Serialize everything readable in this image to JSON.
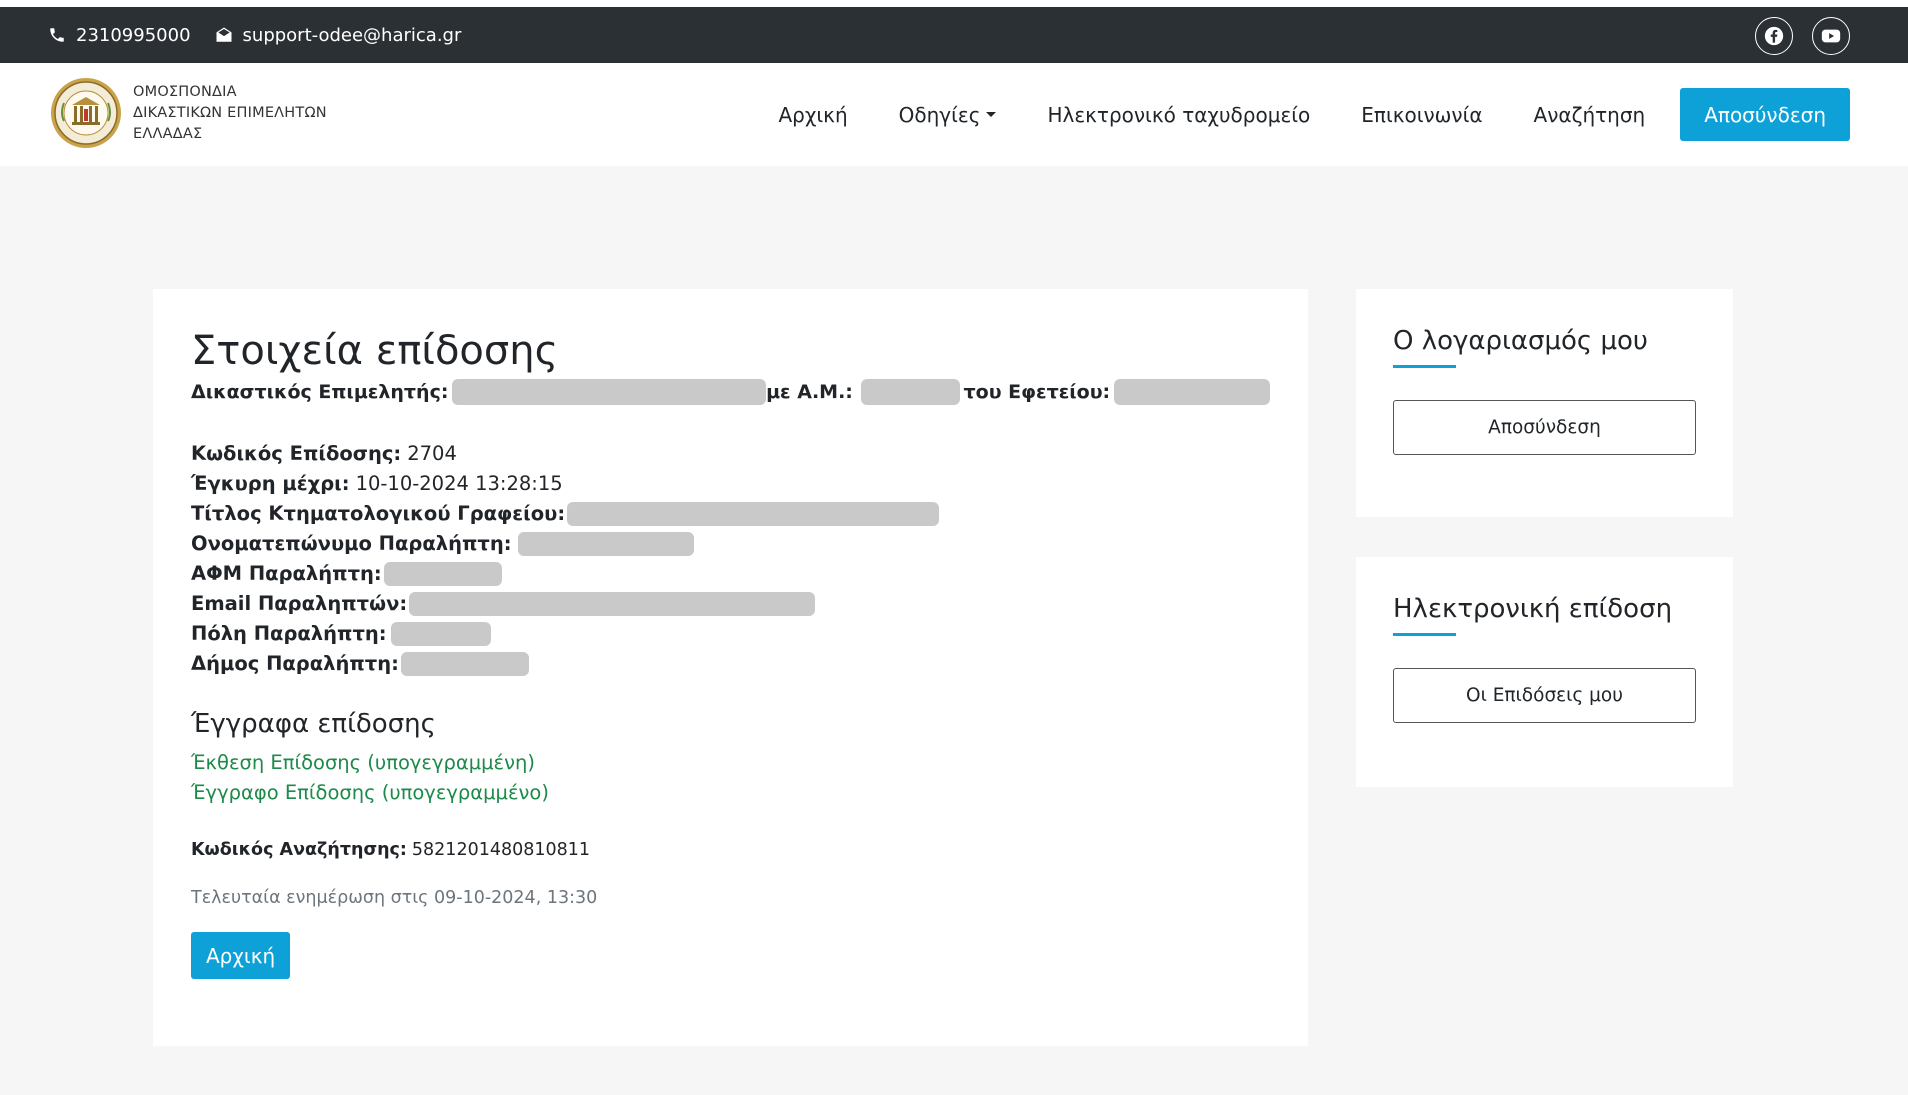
{
  "topbar": {
    "phone": "2310995000",
    "email": "support-odee@harica.gr",
    "social": [
      "facebook-icon",
      "youtube-icon"
    ]
  },
  "brand": {
    "line1": "ΟΜΟΣΠΟΝΔΙΑ",
    "line2": "ΔΙΚΑΣΤΙΚΩΝ ΕΠΙΜΕΛΗΤΩΝ",
    "line3": "ΕΛΛΑΔΑΣ"
  },
  "nav": {
    "home": "Αρχική",
    "instructions": "Οδηγίες",
    "email": "Ηλεκτρονικό ταχυδρομείο",
    "contact": "Επικοινωνία",
    "search": "Αναζήτηση",
    "logout": "Αποσύνδεση"
  },
  "main": {
    "title": "Στοιχεία επίδοσης",
    "officer_label": "Δικαστικός Επιμελητής:",
    "am_label": "με Α.Μ.:",
    "court_label": "του Εφετείου:",
    "fields": [
      {
        "label": "Κωδικός Επίδοσης:",
        "value": "2704"
      },
      {
        "label": "Έγκυρη μέχρι:",
        "value": "10-10-2024 13:28:15"
      },
      {
        "label": "Τίτλος Κτηματολογικού Γραφείου:",
        "value": ""
      },
      {
        "label": "Ονοματεπώνυμο Παραλήπτη:",
        "value": ""
      },
      {
        "label": "ΑΦΜ Παραλήπτη:",
        "value": ""
      },
      {
        "label": "Email Παραληπτών:",
        "value": ""
      },
      {
        "label": "Πόλη Παραλήπτη:",
        "value": ""
      },
      {
        "label": "Δήμος Παραλήπτη:",
        "value": ""
      }
    ],
    "documents_title": "Έγγραφα επίδοσης",
    "documents": [
      "Έκθεση Επίδοσης (υπογεγραμμένη)",
      "Έγγραφο Επίδοσης (υπογεγραμμένο)"
    ],
    "search_code_label": "Κωδικός Αναζήτησης:",
    "search_code_value": "5821201480810811",
    "last_updated": "Τελευταία ενημέρωση στις 09-10-2024, 13:30",
    "home_button": "Αρχική"
  },
  "sidebar": {
    "account": {
      "title": "Ο λογαριασμός μου",
      "button": "Αποσύνδεση"
    },
    "eservice": {
      "title": "Ηλεκτρονική επίδοση",
      "button": "Οι Επιδόσεις μου"
    }
  },
  "colors": {
    "accent": "#0da1d8",
    "topbar": "#2b3035",
    "link_green": "#1e8a4a",
    "page_bg": "#f6f6f6"
  }
}
